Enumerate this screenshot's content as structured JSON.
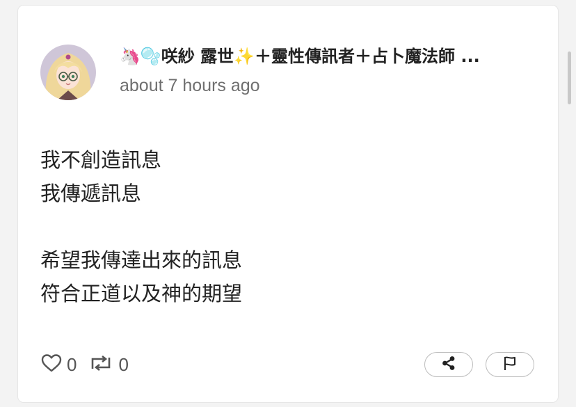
{
  "post": {
    "author_name": "🦄🫧咲紗 露世✨＋靈性傳訊者＋占卜魔法師 ...",
    "timestamp": "about 7 hours ago",
    "body_lines": [
      "我不創造訊息",
      "我傳遞訊息",
      "",
      "希望我傳達出來的訊息",
      "符合正道以及神的期望"
    ]
  },
  "actions": {
    "like_count": "0",
    "repost_count": "0"
  },
  "icons": {
    "like": "heart-icon",
    "repost": "repost-icon",
    "share": "share-icon",
    "report": "flag-icon"
  },
  "colors": {
    "background": "#f3f3f3",
    "card": "#ffffff",
    "text": "#222222",
    "muted_text": "#6f6f6f",
    "pill_border": "#bdbdbd"
  }
}
